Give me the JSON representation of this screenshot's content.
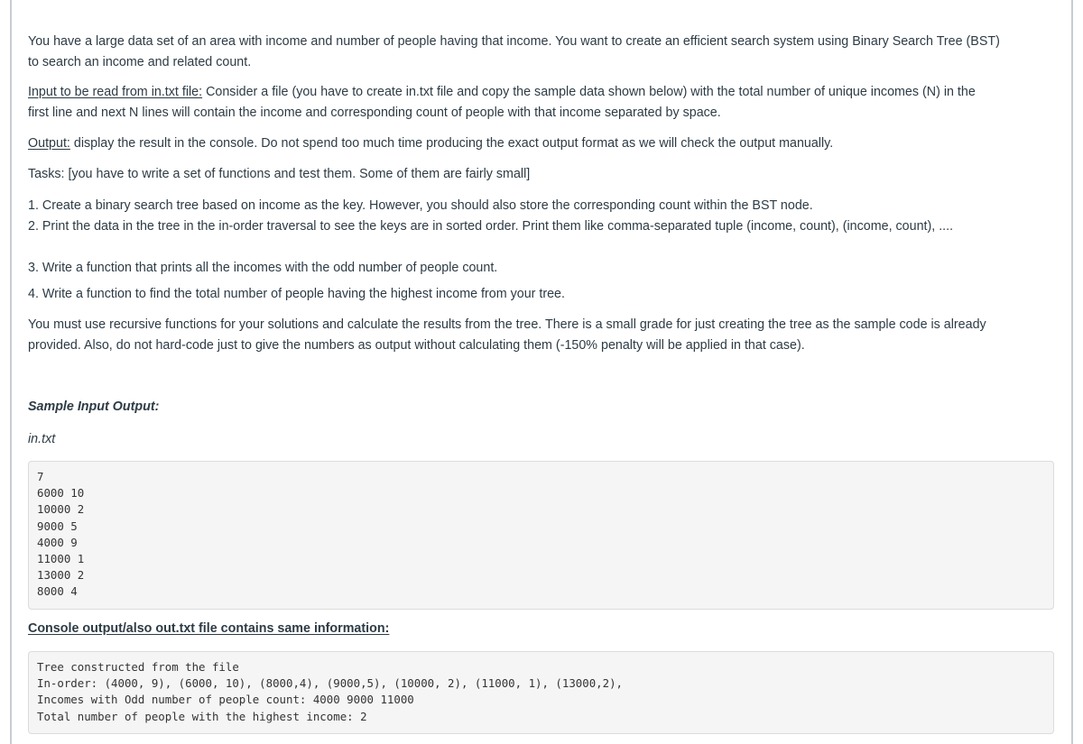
{
  "intro": {
    "line1": "You have a large data set of an area with income and number of people having that income. You want to create an efficient search system using Binary Search Tree (BST)",
    "line2": "to search an income and related count."
  },
  "input_section": {
    "label": "Input to be read from in.txt file:",
    "text_line1": " Consider a file (you have to create in.txt file and copy the sample data shown below) with the total number of unique incomes (N) in the",
    "text_line2": "first line and next N lines will contain the income and corresponding count of people with that income separated by space."
  },
  "output_section": {
    "label": "Output:",
    "text": " display the result in the console. Do not spend too much time producing the exact output format as we will check the output manually."
  },
  "tasks_intro": "Tasks: [you have to write a set of functions and test them. Some of them are fairly small]",
  "tasks": [
    "1. Create a binary search tree based on income as the key. However, you should also store the corresponding count within the BST node.",
    "2. Print the data in the tree in the in-order traversal to see the keys are in sorted order. Print them like comma-separated tuple (income, count), (income, count), ....",
    "3. Write a function that prints all the incomes with the odd number of people count.",
    "4. Write a function to find the total number of people having the highest income from your tree."
  ],
  "note": {
    "line1": "You must use recursive functions for your solutions and calculate the results from the tree. There is a small grade for just creating the tree as the sample code is already",
    "line2": "provided. Also, do not hard-code just to give the numbers as output without calculating them (-150% penalty will be applied in that case)."
  },
  "sample_heading": "Sample Input Output:",
  "input_file_label": "in.txt",
  "input_file_lines": [
    "7",
    "6000 10",
    "10000 2",
    "9000 5",
    "4000 9",
    "11000 1",
    "13000 2",
    "8000 4"
  ],
  "console_heading": "Console output/also out.txt file contains same information:",
  "console_lines": [
    "Tree constructed from the file",
    "In-order: (4000, 9), (6000, 10), (8000,4), (9000,5), (10000, 2), (11000, 1), (13000,2),",
    "Incomes with Odd number of people count: 4000 9000 11000",
    "Total number of people with the highest income: 2"
  ]
}
